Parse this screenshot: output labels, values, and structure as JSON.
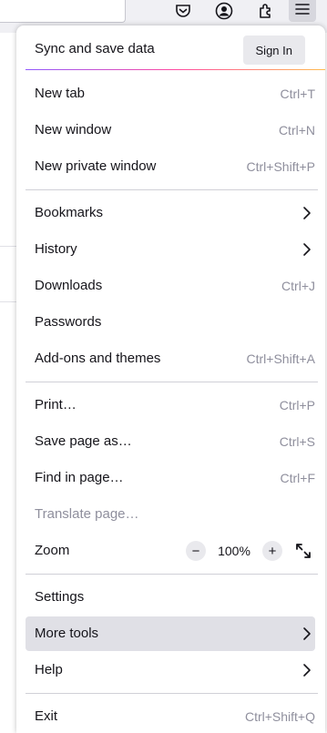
{
  "toolbar": {
    "icons": [
      "pocket-icon",
      "account-icon",
      "extensions-icon",
      "hamburger-menu-icon"
    ]
  },
  "menu": {
    "sync_title": "Sync and save data",
    "sign_in_label": "Sign In",
    "groups": [
      [
        {
          "label": "New tab",
          "shortcut": "Ctrl+T"
        },
        {
          "label": "New window",
          "shortcut": "Ctrl+N"
        },
        {
          "label": "New private window",
          "shortcut": "Ctrl+Shift+P"
        }
      ],
      [
        {
          "label": "Bookmarks",
          "submenu": true
        },
        {
          "label": "History",
          "submenu": true
        },
        {
          "label": "Downloads",
          "shortcut": "Ctrl+J"
        },
        {
          "label": "Passwords"
        },
        {
          "label": "Add-ons and themes",
          "shortcut": "Ctrl+Shift+A"
        }
      ],
      [
        {
          "label": "Print…",
          "shortcut": "Ctrl+P"
        },
        {
          "label": "Save page as…",
          "shortcut": "Ctrl+S"
        },
        {
          "label": "Find in page…",
          "shortcut": "Ctrl+F"
        },
        {
          "label": "Translate page…",
          "disabled": true
        }
      ]
    ],
    "zoom": {
      "label": "Zoom",
      "minus": "−",
      "value": "100%",
      "plus": "+"
    },
    "settings": {
      "label": "Settings"
    },
    "more_tools": {
      "label": "More tools",
      "submenu": true,
      "hovered": true
    },
    "help": {
      "label": "Help",
      "submenu": true
    },
    "exit": {
      "label": "Exit",
      "shortcut": "Ctrl+Shift+Q"
    }
  },
  "colors": {
    "accent_gradient": [
      "#9059ff",
      "#ff4aa2",
      "#ffbd4f"
    ],
    "hover_bg": "#e0e0e6"
  }
}
